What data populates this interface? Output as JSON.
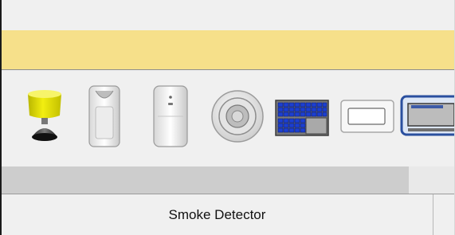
{
  "colors": {
    "banner": "#f6e08a",
    "panel": "#f0f0f0",
    "scroll_thumb": "#cdcdcd",
    "lamp_shade": "#e4e000"
  },
  "palette": {
    "devices": [
      {
        "icon": "table-lamp-icon"
      },
      {
        "icon": "motion-sensor-icon"
      },
      {
        "icon": "wall-sensor-icon"
      },
      {
        "icon": "smoke-detector-icon"
      },
      {
        "icon": "solar-panel-icon"
      },
      {
        "icon": "light-switch-icon"
      },
      {
        "icon": "window-icon"
      }
    ]
  },
  "status": {
    "selected_device_label": "Smoke Detector"
  }
}
